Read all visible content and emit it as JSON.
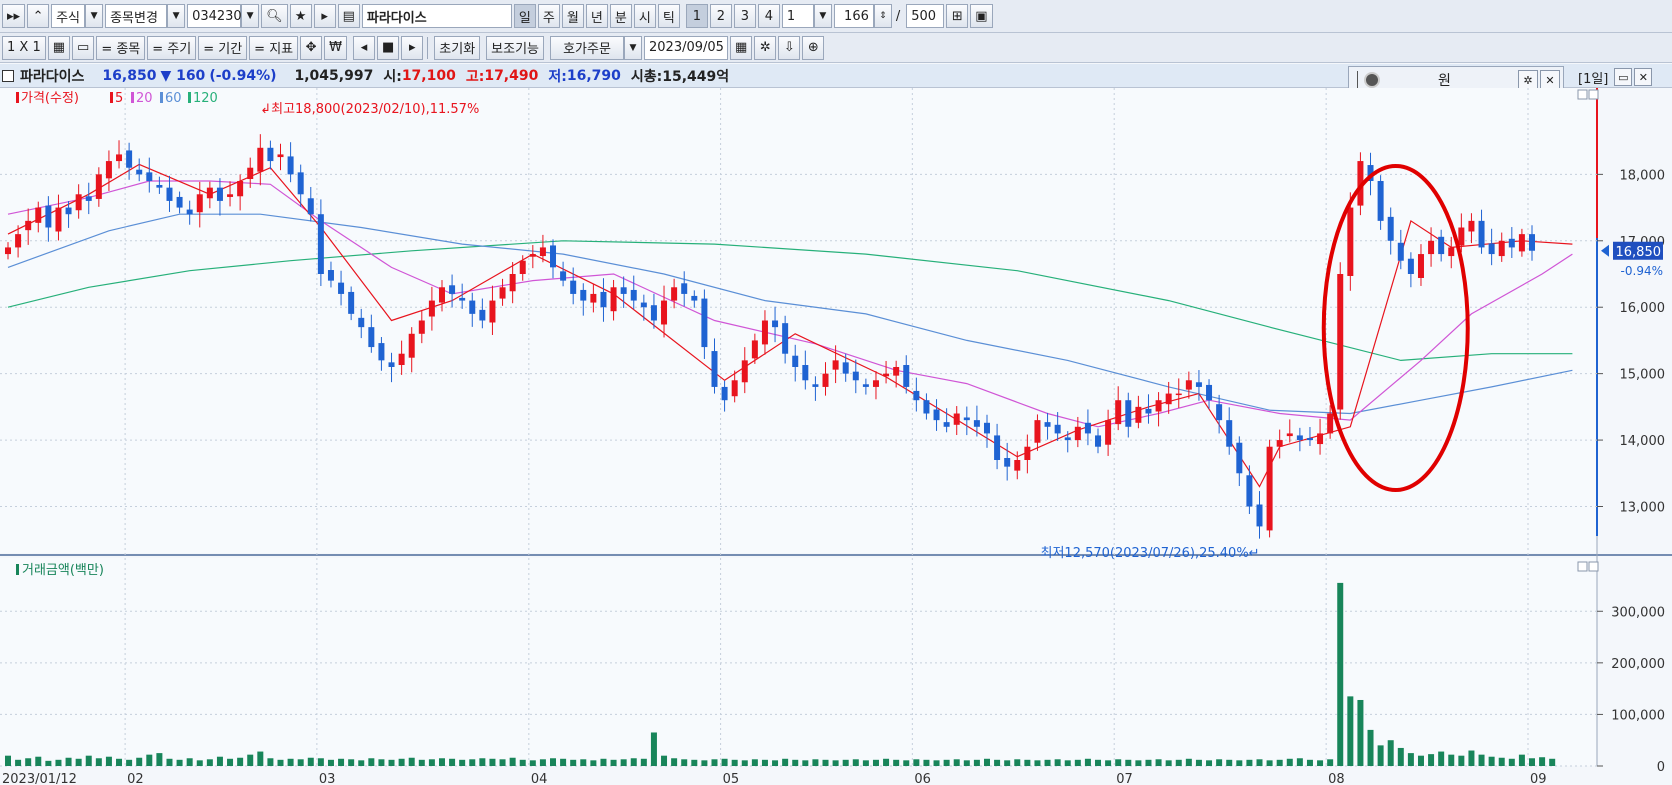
{
  "toolbar1": {
    "market": "주식",
    "change_label": "종목변경",
    "code": "034230",
    "name": "파라다이스",
    "periods": [
      "일",
      "주",
      "월",
      "년",
      "분",
      "시",
      "틱"
    ],
    "nums": [
      "1",
      "2",
      "3",
      "4"
    ],
    "count_value": "1",
    "bars_value": "166",
    "slash": "/",
    "max_value": "500"
  },
  "toolbar2": {
    "layout": "1 X 1",
    "buttons": [
      "= 종목",
      "= 주기",
      "= 기간",
      "= 지표"
    ],
    "reset": "초기화",
    "aux": "보조기능",
    "order": "호가주문",
    "date": "2023/09/05"
  },
  "infobar": {
    "name": "파라다이스",
    "price": "16,850",
    "change": "▼ 160",
    "pct": "(-0.94%)",
    "volume": "1,045,997",
    "open_label": "시:",
    "open": "17,100",
    "high_label": "고:",
    "high": "17,490",
    "low_label": "저:",
    "low": "16,790",
    "cap": "시총:15,449억"
  },
  "unit": {
    "label": "원"
  },
  "panel": {
    "period_label": "[1일]"
  },
  "colors": {
    "up": "#e8141e",
    "down": "#1f63d2",
    "ma5": "#e8141e",
    "ma20": "#d056d6",
    "ma60": "#5b8fd6",
    "ma120": "#27b07a",
    "volume": "#18855a",
    "highlight": "#e00000"
  },
  "chart_data": [
    {
      "type": "candlestick",
      "legend": [
        "가격(수정)",
        "5",
        "20",
        "60",
        "120"
      ],
      "ylim": [
        12300,
        19300
      ],
      "yticks": [
        "13,000",
        "14,000",
        "15,000",
        "16,000",
        "17,000",
        "18,000"
      ],
      "ytick_values": [
        13000,
        14000,
        15000,
        16000,
        17000,
        18000
      ],
      "last_price_label": "16,850",
      "last_pct_label": "-0.94%",
      "last_price": 16850,
      "annotations": {
        "high_text": "최고18,800(2023/02/10),11.57%",
        "high_value": 18800,
        "low_text": "최저12,570(2023/07/26),25.40%",
        "low_value": 12570
      },
      "x_labels": [
        "2023/01/12",
        "02",
        "03",
        "04",
        "05",
        "06",
        "07",
        "08",
        "09"
      ],
      "ohlc_closes": [
        16900,
        17100,
        17300,
        17500,
        17200,
        17500,
        17400,
        17700,
        17600,
        18000,
        18200,
        18300,
        18100,
        18000,
        17900,
        17800,
        17600,
        17500,
        17400,
        17700,
        17800,
        17600,
        17700,
        17900,
        18100,
        18400,
        18200,
        18300,
        18000,
        17700,
        17400,
        16500,
        16400,
        16200,
        15900,
        15700,
        15400,
        15200,
        15100,
        15300,
        15600,
        15800,
        16100,
        16300,
        16200,
        16100,
        15900,
        15800,
        16100,
        16300,
        16500,
        16700,
        16800,
        16900,
        16600,
        16400,
        16200,
        16100,
        16200,
        16000,
        16300,
        16200,
        16100,
        16000,
        15800,
        16100,
        16300,
        16200,
        16100,
        15400,
        14800,
        14600,
        14900,
        15200,
        15500,
        15800,
        15700,
        15300,
        15100,
        14900,
        14800,
        15000,
        15200,
        15000,
        14900,
        14800,
        14900,
        15000,
        15100,
        14800,
        14600,
        14400,
        14300,
        14200,
        14400,
        14300,
        14200,
        14100,
        13700,
        13600,
        13700,
        13900,
        14300,
        14200,
        14100,
        14000,
        14200,
        14100,
        13900,
        14300,
        14600,
        14200,
        14500,
        14400,
        14600,
        14700,
        14700,
        14900,
        14800,
        14600,
        14300,
        13900,
        13500,
        13000,
        12700,
        13900,
        14000,
        14100,
        14000,
        14000,
        14100,
        14400,
        16500,
        17500,
        18200,
        17900,
        17300,
        17000,
        16700,
        16500,
        16800,
        17000,
        16800,
        16900,
        17200,
        17300,
        16900,
        16800,
        17000,
        16900,
        17100,
        16850
      ],
      "ma_series": {
        "ma5": [
          [
            17100,
            0
          ],
          [
            17700,
            8
          ],
          [
            18150,
            13
          ],
          [
            17700,
            20
          ],
          [
            18100,
            26
          ],
          [
            17200,
            31
          ],
          [
            15800,
            38
          ],
          [
            16100,
            44
          ],
          [
            16800,
            52
          ],
          [
            16200,
            60
          ],
          [
            14900,
            71
          ],
          [
            15600,
            78
          ],
          [
            14950,
            87
          ],
          [
            14400,
            93
          ],
          [
            13750,
            100
          ],
          [
            14150,
            106
          ],
          [
            14500,
            113
          ],
          [
            14700,
            118
          ],
          [
            13300,
            124
          ],
          [
            13900,
            126
          ],
          [
            14200,
            133
          ],
          [
            17300,
            139
          ],
          [
            16900,
            143
          ],
          [
            17000,
            150
          ],
          [
            16950,
            155
          ]
        ],
        "ma20": [
          [
            17400,
            0
          ],
          [
            17650,
            8
          ],
          [
            17900,
            14
          ],
          [
            17900,
            20
          ],
          [
            17850,
            26
          ],
          [
            17300,
            31
          ],
          [
            16600,
            38
          ],
          [
            16200,
            44
          ],
          [
            16400,
            52
          ],
          [
            16500,
            60
          ],
          [
            15800,
            70
          ],
          [
            15450,
            80
          ],
          [
            15050,
            88
          ],
          [
            14850,
            95
          ],
          [
            14400,
            103
          ],
          [
            14200,
            108
          ],
          [
            14400,
            114
          ],
          [
            14600,
            119
          ],
          [
            14400,
            126
          ],
          [
            14300,
            133
          ],
          [
            15200,
            140
          ],
          [
            15900,
            145
          ],
          [
            16500,
            152
          ],
          [
            16800,
            155
          ]
        ],
        "ma60": [
          [
            16600,
            0
          ],
          [
            17150,
            10
          ],
          [
            17400,
            17
          ],
          [
            17400,
            25
          ],
          [
            17200,
            35
          ],
          [
            16950,
            45
          ],
          [
            16800,
            55
          ],
          [
            16500,
            65
          ],
          [
            16100,
            75
          ],
          [
            15900,
            85
          ],
          [
            15500,
            95
          ],
          [
            15200,
            105
          ],
          [
            14800,
            115
          ],
          [
            14450,
            125
          ],
          [
            14400,
            133
          ],
          [
            14600,
            140
          ],
          [
            14800,
            147
          ],
          [
            15050,
            155
          ]
        ],
        "ma120": [
          [
            16000,
            0
          ],
          [
            16300,
            8
          ],
          [
            16550,
            18
          ],
          [
            16700,
            28
          ],
          [
            16850,
            40
          ],
          [
            17000,
            55
          ],
          [
            16950,
            70
          ],
          [
            16800,
            85
          ],
          [
            16550,
            100
          ],
          [
            16100,
            115
          ],
          [
            15700,
            125
          ],
          [
            15200,
            138
          ],
          [
            15300,
            147
          ],
          [
            15300,
            155
          ]
        ]
      }
    },
    {
      "type": "bar",
      "legend": [
        "거래금액(백만)"
      ],
      "ylim": [
        0,
        380000
      ],
      "yticks": [
        "0",
        "100,000",
        "200,000",
        "300,000"
      ],
      "ytick_values": [
        0,
        100000,
        200000,
        300000
      ],
      "x_labels": [
        "2023/01/12",
        "02",
        "03",
        "04",
        "05",
        "06",
        "07",
        "08",
        "09"
      ],
      "values": [
        20000,
        12000,
        15000,
        18000,
        10000,
        12000,
        16000,
        14000,
        20000,
        15000,
        18000,
        14000,
        12000,
        16000,
        22000,
        25000,
        14000,
        12000,
        15000,
        11000,
        13000,
        18000,
        14000,
        16000,
        22000,
        28000,
        15000,
        12000,
        14000,
        13000,
        16000,
        15000,
        12000,
        14000,
        13000,
        11000,
        15000,
        13000,
        12000,
        14000,
        16000,
        12000,
        13000,
        15000,
        14000,
        12000,
        13000,
        15000,
        14000,
        13000,
        16000,
        12000,
        11000,
        13000,
        15000,
        14000,
        12000,
        13000,
        11000,
        14000,
        12000,
        13000,
        15000,
        14000,
        65000,
        20000,
        15000,
        13000,
        12000,
        11000,
        13000,
        14000,
        12000,
        11000,
        13000,
        12000,
        11000,
        14000,
        12000,
        11000,
        13000,
        12000,
        11000,
        12000,
        13000,
        11000,
        12000,
        14000,
        12000,
        11000,
        13000,
        12000,
        11000,
        12000,
        13000,
        11000,
        12000,
        14000,
        12000,
        11000,
        13000,
        12000,
        11000,
        12000,
        13000,
        11000,
        12000,
        14000,
        12000,
        11000,
        13000,
        12000,
        11000,
        12000,
        13000,
        11000,
        12000,
        14000,
        12000,
        11000,
        13000,
        12000,
        11000,
        12000,
        13000,
        11000,
        12000,
        14000,
        15000,
        12000,
        11000,
        13000,
        355000,
        135000,
        128000,
        70000,
        40000,
        50000,
        35000,
        25000,
        20000,
        23000,
        28000,
        22000,
        20000,
        30000,
        22000,
        18000,
        16000,
        14000,
        22000,
        15000,
        17000,
        14000
      ]
    }
  ]
}
